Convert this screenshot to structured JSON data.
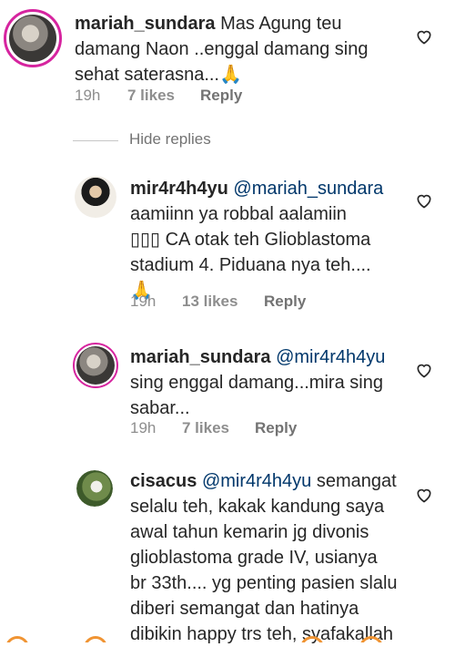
{
  "comments": [
    {
      "username": "mariah_sundara",
      "mention": "",
      "lines": [
        "Mas Agung teu",
        "damang Naon ..enggal damang sing",
        "sehat saterasna...🙏"
      ],
      "time": "19h",
      "likes": "7 likes",
      "reply": "Reply"
    },
    {
      "username": "mir4r4h4yu",
      "mention": "@mariah_sundara",
      "lines": [
        "aamiinn ya robbal aalamiin",
        "▯▯▯ CA otak teh Glioblastoma",
        "stadium 4.  Piduana nya teh....",
        "🙏"
      ],
      "time": "19h",
      "likes": "13 likes",
      "reply": "Reply"
    },
    {
      "username": "mariah_sundara",
      "mention": "@mir4r4h4yu",
      "lines": [
        "sing enggal damang...mira sing",
        "sabar..."
      ],
      "time": "19h",
      "likes": "7 likes",
      "reply": "Reply"
    },
    {
      "username": "cisacus",
      "mention": "@mir4r4h4yu",
      "first_tail": "semangat",
      "lines": [
        "selalu teh, kakak kandung saya",
        "awal tahun kemarin jg divonis",
        "glioblastoma grade IV, usianya",
        "br 33th.... yg penting pasien slalu",
        "diberi semangat dan hatinya",
        "dibikin happy trs teh, syafakallah"
      ]
    }
  ],
  "hide_replies": "Hide replies",
  "icons": {
    "like": "heart-outline-icon"
  },
  "colors": {
    "mention": "#00376b",
    "meta": "#8e8e8e",
    "ring": "#d6249f"
  }
}
